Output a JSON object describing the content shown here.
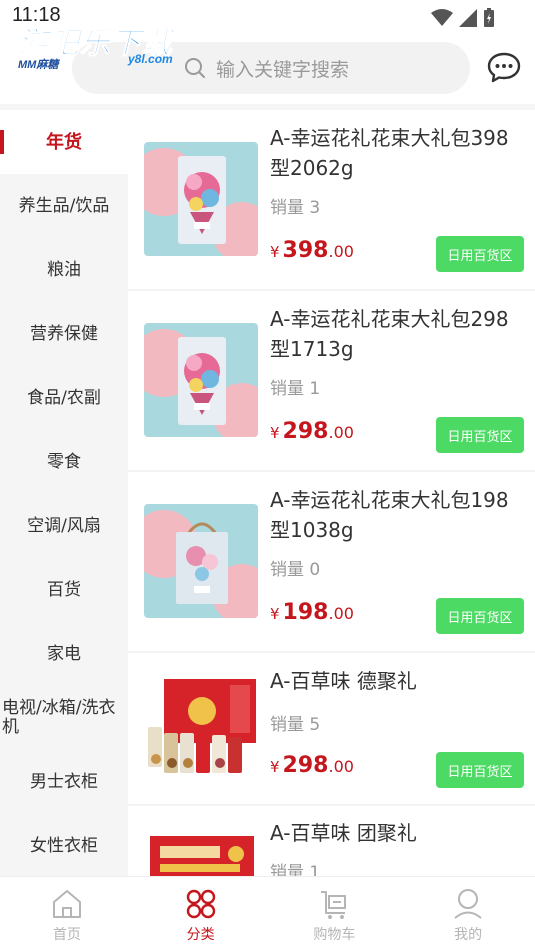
{
  "status_bar": {
    "time": "11:18"
  },
  "watermark": {
    "title": "游吧乐下载",
    "domain": "y8l.com",
    "brand": "MM麻糖"
  },
  "header": {
    "search_placeholder": "输入关键字搜索"
  },
  "sidebar": {
    "items": [
      {
        "label": "年货",
        "active": true
      },
      {
        "label": "养生品/饮品"
      },
      {
        "label": "粮油"
      },
      {
        "label": "营养保健"
      },
      {
        "label": "食品/农副"
      },
      {
        "label": "零食"
      },
      {
        "label": "空调/风扇"
      },
      {
        "label": "百货"
      },
      {
        "label": "家电"
      },
      {
        "label": "电视/冰箱/洗衣机"
      },
      {
        "label": "男士衣柜"
      },
      {
        "label": "女性衣柜"
      }
    ]
  },
  "products": [
    {
      "name": "A-幸运花礼花束大礼包398型2062g",
      "sales": "销量 3",
      "currency": "¥",
      "price_int": "398",
      "price_dec": ".00",
      "tag": "日用百货区",
      "image": "flower-gift-box"
    },
    {
      "name": "A-幸运花礼花束大礼包298型1713g",
      "sales": "销量 1",
      "currency": "¥",
      "price_int": "298",
      "price_dec": ".00",
      "tag": "日用百货区",
      "image": "flower-gift-box"
    },
    {
      "name": "A-幸运花礼花束大礼包198型1038g",
      "sales": "销量 0",
      "currency": "¥",
      "price_int": "198",
      "price_dec": ".00",
      "tag": "日用百货区",
      "image": "flower-gift-bag"
    },
    {
      "name": "A-百草味 德聚礼",
      "sales": "销量 5",
      "currency": "¥",
      "price_int": "298",
      "price_dec": ".00",
      "tag": "日用百货区",
      "image": "snack-gift-box"
    },
    {
      "name": "A-百草味 团聚礼",
      "sales": "销量 1",
      "currency": "¥",
      "price_int": "",
      "price_dec": "",
      "tag": "",
      "image": "snack-gift-box-red"
    }
  ],
  "tabbar": {
    "tabs": [
      {
        "label": "首页",
        "icon": "home-icon"
      },
      {
        "label": "分类",
        "icon": "category-icon",
        "active": true
      },
      {
        "label": "购物车",
        "icon": "cart-icon"
      },
      {
        "label": "我的",
        "icon": "user-icon"
      }
    ]
  },
  "colors": {
    "accent": "#c4161c",
    "tag_green": "#4cd964",
    "sidebar_bg": "#f5f5f5",
    "inactive_tab": "#b5b5b5"
  }
}
